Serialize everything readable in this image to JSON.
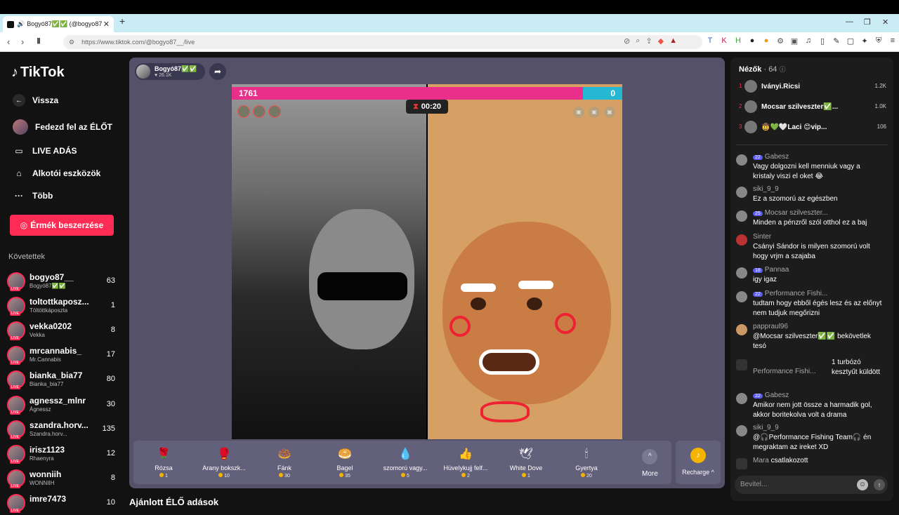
{
  "browser": {
    "tab_title": "Bogyó87✅✅ (@bogyo87",
    "url": "https://www.tiktok.com/@bogyo87__/live"
  },
  "sidebar": {
    "logo": "TikTok",
    "back": "Vissza",
    "nav": [
      {
        "label": "Fedezd fel az ÉLŐT",
        "icon": "avatar-icon"
      },
      {
        "label": "LIVE ADÁS",
        "icon": "video-icon"
      },
      {
        "label": "Alkotói eszközök",
        "icon": "tools-icon"
      },
      {
        "label": "Több",
        "icon": "more-icon"
      }
    ],
    "coin_button": "Érmék beszerzése",
    "following_header": "Követettek",
    "following": [
      {
        "name": "bogyo87__",
        "sub": "Bogyó87✅✅",
        "count": "63"
      },
      {
        "name": "toltottkaposz...",
        "sub": "Töltöttkáposzta",
        "count": "1"
      },
      {
        "name": "vekka0202",
        "sub": "Vekka",
        "count": "8"
      },
      {
        "name": "mrcannabis_",
        "sub": "Mr.Cannabis",
        "count": "17"
      },
      {
        "name": "bianka_bia77",
        "sub": "Bianka_bia77",
        "count": "80"
      },
      {
        "name": "agnessz_mlnr",
        "sub": "Ágnessz",
        "count": "30"
      },
      {
        "name": "szandra.horv...",
        "sub": "Szandra.horv...",
        "count": "135"
      },
      {
        "name": "irisz1123",
        "sub": "Rhaenyra",
        "count": "12"
      },
      {
        "name": "wonniih",
        "sub": "WONNIIH",
        "count": "8"
      },
      {
        "name": "imre7473",
        "sub": "",
        "count": "10"
      }
    ]
  },
  "stage": {
    "host_name": "Bogyó87✅✅",
    "host_likes": "♥ 26.1K",
    "score_left": "1761",
    "score_right": "0",
    "timer": "00:20",
    "gifts": [
      {
        "name": "Rózsa",
        "price": "1",
        "icon": "rose-icon",
        "glyph": "🌹"
      },
      {
        "name": "Arany bokszk...",
        "price": "10",
        "icon": "gold-glove-icon",
        "glyph": "🥊"
      },
      {
        "name": "Fánk",
        "price": "30",
        "icon": "donut-icon",
        "glyph": "🍩"
      },
      {
        "name": "Bagel",
        "price": "35",
        "icon": "bagel-icon",
        "glyph": "🥯"
      },
      {
        "name": "szomorú vagy...",
        "price": "5",
        "icon": "sad-icon",
        "glyph": "💧"
      },
      {
        "name": "Hüvelykujj felf...",
        "price": "2",
        "icon": "thumbs-up-icon",
        "glyph": "👍"
      },
      {
        "name": "White Dove",
        "price": "1",
        "icon": "dove-icon",
        "glyph": "🕊"
      },
      {
        "name": "Gyertya",
        "price": "20",
        "icon": "candle-icon",
        "glyph": "🕯"
      }
    ],
    "more_label": "More",
    "recharge_label": "Recharge ^",
    "recommended": "Ajánlott ÉLŐ adások"
  },
  "viewers": {
    "title": "Nézők",
    "count": "· 64",
    "top": [
      {
        "rank": "1",
        "name": "Iványi.Ricsi",
        "score": "1.2K"
      },
      {
        "rank": "2",
        "name": "Mocsar szilveszter✅...",
        "score": "1.0K"
      },
      {
        "rank": "3",
        "name": "🤠💚🤍Laci 😊vip...",
        "score": "106"
      }
    ]
  },
  "chat": [
    {
      "name": "Gabesz",
      "badge": "22",
      "text": "Vagy dolgozni kell menniuk vagy a kristaly viszi el oket 😂"
    },
    {
      "name": "siki_9_9",
      "badge": "",
      "text": "Ez a szomorú az egészben"
    },
    {
      "name": "Mocsar szilveszter...",
      "badge": "25",
      "text": "Minden a pénzről szól otthol ez a baj"
    },
    {
      "name": "Sinter",
      "badge": "",
      "text": "Csányi Sándor is milyen szomorú volt hogy vrjm a szajaba"
    },
    {
      "name": "Pannaa",
      "badge": "18",
      "text": "igy igaz"
    },
    {
      "name": "Performance Fishi...",
      "badge": "22",
      "text": "tudtam hogy ebből égés lesz és az előnyt nem tudjuk megőrizni"
    },
    {
      "name": "pappraul96",
      "badge": "",
      "text": "@Mocsar szilveszter✅✅ bekövetlek tesó"
    },
    {
      "name": "Performance Fishi...",
      "badge": "",
      "text": "1 turbózó kesztyűt küldött"
    },
    {
      "name": "Gabesz",
      "badge": "22",
      "text": "Amikor nem jott össze a harmadik gol, akkor boritekolva volt a drama"
    },
    {
      "name": "siki_9_9",
      "badge": "",
      "text": "@🎧Performance Fishing Team🎧 én megraktam az ireket XD"
    },
    {
      "name": "Mara",
      "badge": "",
      "text": "csatlakozott"
    }
  ],
  "input_placeholder": "Bevitel..."
}
